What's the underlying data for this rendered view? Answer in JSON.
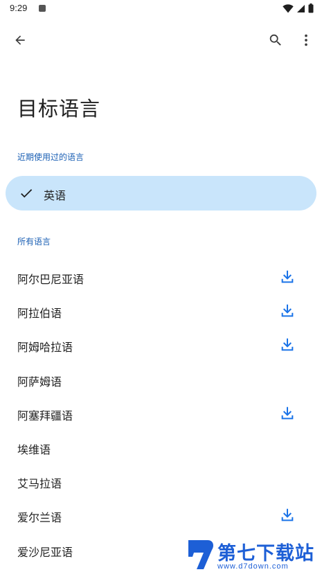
{
  "status_bar": {
    "time": "9:29"
  },
  "toolbar": {
    "back_icon": "arrow-back-icon",
    "search_icon": "search-icon",
    "more_icon": "more-vert-icon"
  },
  "page": {
    "title": "目标语言"
  },
  "recent": {
    "label": "近期使用过的语言",
    "items": [
      {
        "name": "英语",
        "selected": true
      }
    ]
  },
  "all": {
    "label": "所有语言",
    "items": [
      {
        "name": "阿尔巴尼亚语",
        "downloadable": true
      },
      {
        "name": "阿拉伯语",
        "downloadable": true
      },
      {
        "name": "阿姆哈拉语",
        "downloadable": true
      },
      {
        "name": "阿萨姆语",
        "downloadable": false
      },
      {
        "name": "阿塞拜疆语",
        "downloadable": true
      },
      {
        "name": "埃维语",
        "downloadable": false
      },
      {
        "name": "艾马拉语",
        "downloadable": false
      },
      {
        "name": "爱尔兰语",
        "downloadable": true
      },
      {
        "name": "爱沙尼亚语",
        "downloadable": false
      }
    ]
  },
  "watermark": {
    "title": "第七下载站",
    "url": "www.d7down.com"
  },
  "colors": {
    "accent": "#1a5fb4",
    "selected_bg": "#c9e5fb",
    "download_icon": "#1a73e8"
  }
}
